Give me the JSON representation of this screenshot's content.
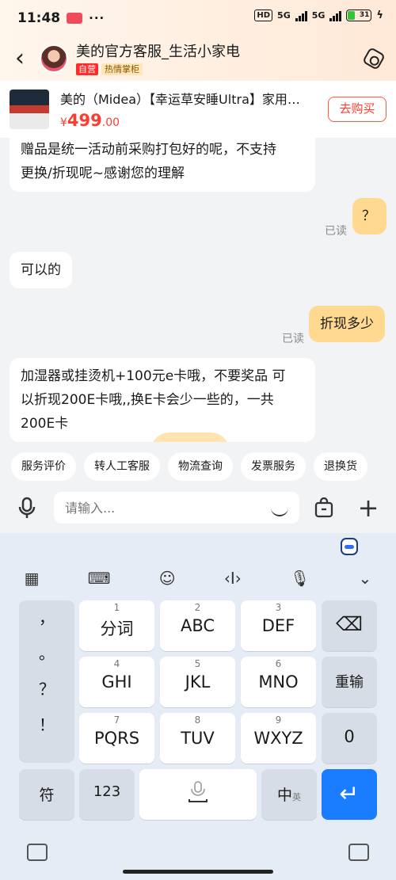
{
  "status_bar": {
    "time": "11:48",
    "dots": "···",
    "hd": "HD",
    "net1": "5G",
    "net2": "5G",
    "battery": "31"
  },
  "header": {
    "back_icon": "chevron-left",
    "shop_name": "美的官方客服_生活小家电",
    "badge_self": "自营",
    "badge_hot": "热情掌柜",
    "settings_icon": "hexagon-settings"
  },
  "product": {
    "title": "美的（Midea）【幸运草安睡Ultra】家用…",
    "price_symbol": "¥",
    "price_int": "499",
    "price_dec": ".00",
    "buy_label": "去购买"
  },
  "messages": [
    {
      "side": "left",
      "text_lines": [
        "赠品是统一活动前采购打包好的呢，不支持",
        "更换/折现呢~感谢您的理解"
      ]
    },
    {
      "side": "right",
      "text": "？",
      "status": "已读"
    },
    {
      "side": "left",
      "text": "可以的"
    },
    {
      "side": "right",
      "text": "折现多少",
      "status": "已读"
    },
    {
      "side": "left",
      "text_lines": [
        "加湿器或挂烫机+100元e卡哦，不要奖品  可",
        "以折现200E卡哦,,换E卡会少一些的，一共",
        "200E卡"
      ]
    }
  ],
  "quick_replies": [
    "服务评价",
    "转人工客服",
    "物流查询",
    "发票服务",
    "退换货"
  ],
  "input": {
    "placeholder": "请输入..."
  },
  "keyboard": {
    "punct": [
      "，",
      "。",
      "？",
      "！"
    ],
    "keys": [
      {
        "num": "1",
        "label": "分词"
      },
      {
        "num": "2",
        "label": "ABC"
      },
      {
        "num": "3",
        "label": "DEF"
      },
      {
        "num": "4",
        "label": "GHI"
      },
      {
        "num": "5",
        "label": "JKL"
      },
      {
        "num": "6",
        "label": "MNO"
      },
      {
        "num": "7",
        "label": "PQRS"
      },
      {
        "num": "8",
        "label": "TUV"
      },
      {
        "num": "9",
        "label": "WXYZ"
      }
    ],
    "backspace": "⌫",
    "reinput": "重输",
    "zero": "0",
    "symbol": "符",
    "num_key": "123",
    "lang_main": "中",
    "lang_sub": "英",
    "enter": "↵"
  }
}
